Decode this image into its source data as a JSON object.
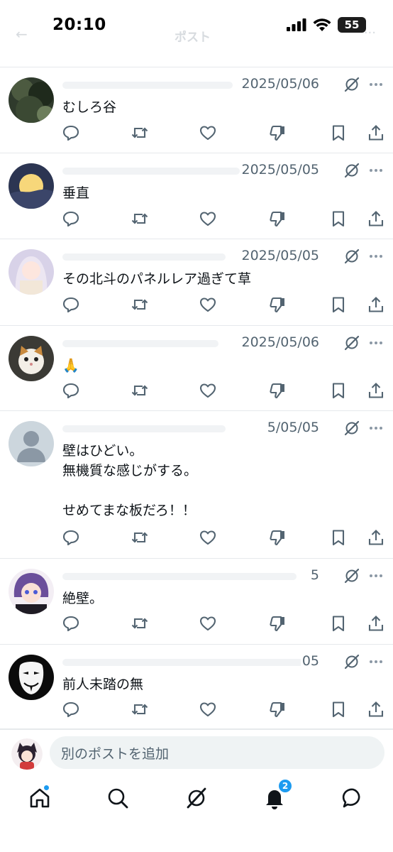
{
  "status_bar": {
    "time": "20:10",
    "battery": "55"
  },
  "header": {
    "back_glyph": "←",
    "title": "ポスト",
    "more_glyph": "···"
  },
  "posts": [
    {
      "date": "2025/05/06",
      "text": "むしろ谷",
      "avatar": "forest-avatar"
    },
    {
      "date": "2025/05/05",
      "text": "垂直",
      "avatar": "moon-avatar"
    },
    {
      "date": "2025/05/05",
      "text": "その北斗のパネルレア過ぎて草",
      "avatar": "anime-girl-avatar"
    },
    {
      "date": "2025/05/06",
      "text": "🙏",
      "avatar": "cat-avatar"
    },
    {
      "date": "5/05/05",
      "text": "壁はひどい。\n無機質な感じがする。\n\nせめてまな板だろ！！",
      "avatar": "default-avatar"
    },
    {
      "date": "5",
      "text": "絶壁。",
      "avatar": "anime-character-avatar"
    },
    {
      "date": "05",
      "text": "前人未踏の無",
      "avatar": "mask-avatar"
    }
  ],
  "composer": {
    "placeholder": "別のポストを追加"
  },
  "bottom_nav": {
    "notification_count": "2"
  },
  "colors": {
    "accent": "#1d9bf0",
    "text": "#0f1419",
    "secondary": "#536471",
    "divider": "#e6e9ec"
  }
}
